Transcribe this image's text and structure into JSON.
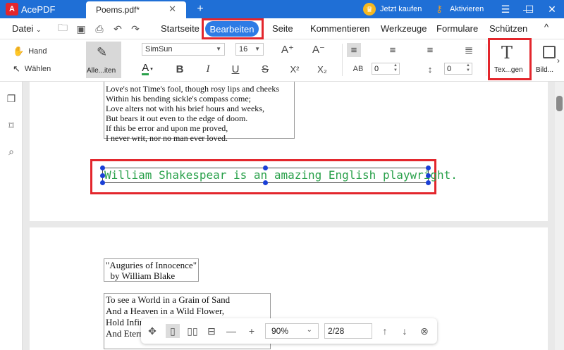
{
  "app": {
    "name": "AcePDF",
    "logo_letter": "A"
  },
  "tabs": [
    {
      "label": "Poems.pdf*",
      "close": "✕"
    }
  ],
  "newtab": "+",
  "title_actions": {
    "buy": "Jetzt kaufen",
    "activate": "Aktivieren"
  },
  "window_controls": {
    "menu": "☰",
    "minimize": "—",
    "maximize": "☐",
    "close": "✕"
  },
  "menu": {
    "file": "Datei",
    "items": [
      "Startseite",
      "Bearbeiten",
      "Seite",
      "Kommentieren",
      "Werkzeuge",
      "Formulare",
      "Schützen"
    ],
    "collapse": "^"
  },
  "ribbon": {
    "hand": "Hand",
    "select": "Wählen",
    "edit_all": "Alle...iten",
    "font": "SimSun",
    "size": "16",
    "bold": "B",
    "italic": "I",
    "underline": "U",
    "strike": "S",
    "superscript": "X²",
    "subscript": "X₂",
    "char_spacing": "0",
    "line_spacing": "0",
    "add_text": "Tex...gen",
    "add_image": "Bild..."
  },
  "document": {
    "poem1_lines": [
      "Love's not Time's fool, though rosy lips and cheeks",
      "Within his bending sickle's compass come;",
      "Love alters not with his brief hours and weeks,",
      "But bears it out even to the edge of doom.",
      "If this be error and upon me proved,",
      "I never writ, nor no man ever loved."
    ],
    "edited_text": "William Shakespear is an amazing English playwright.",
    "poem2_title": [
      "\"Auguries of Innocence\"",
      "  by William Blake"
    ],
    "poem2_lines": [
      "To see a World in a Grain of Sand",
      "And a Heaven in a Wild Flower,",
      "Hold Infinity in the palm of your hand",
      "And Eternity in an hour."
    ]
  },
  "zoom": {
    "value": "90%",
    "page": "2/28"
  },
  "colors": {
    "accent": "#1f6fd6",
    "highlight": "#e3262c",
    "text_green": "#2aa14b",
    "handle": "#1a3fd6"
  }
}
